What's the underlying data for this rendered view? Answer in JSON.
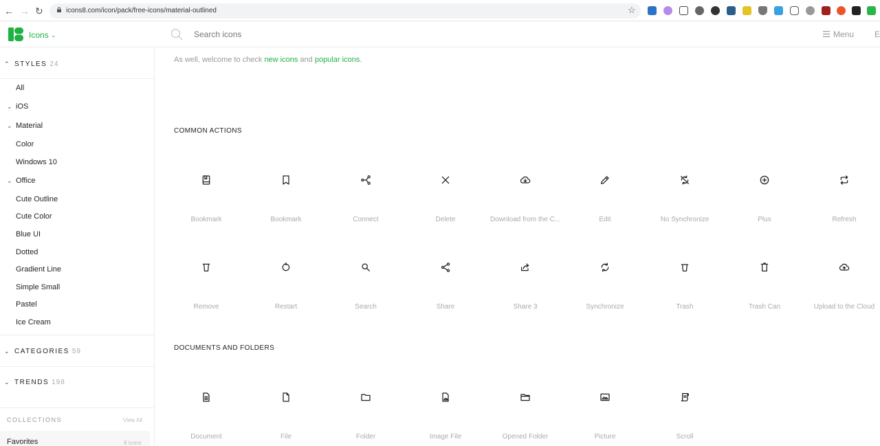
{
  "browser": {
    "url": "icons8.com/icon/pack/free-icons/material-outlined"
  },
  "header": {
    "brand": "Icons",
    "search_placeholder": "Search icons",
    "menu_label": "Menu",
    "edge_letter": "E"
  },
  "sidebar": {
    "styles_label": "STYLES",
    "styles_count": "24",
    "style_items": [
      "All",
      "iOS",
      "Material",
      "Color",
      "Windows 10",
      "Office",
      "Cute Outline",
      "Cute Color",
      "Blue UI",
      "Dotted",
      "Gradient Line",
      "Simple Small",
      "Pastel",
      "Ice Cream"
    ],
    "categories_label": "CATEGORIES",
    "categories_count": "59",
    "trends_label": "TRENDS",
    "trends_count": "198",
    "collections_label": "COLLECTIONS",
    "view_all": "View All",
    "favorites_label": "Favorites",
    "favorites_count": "8 icons"
  },
  "intro": {
    "before": "As well, welcome to check ",
    "new_icons": "new icons",
    "middle": " and ",
    "popular_icons": "popular icons",
    "after": "."
  },
  "sections": [
    {
      "title": "COMMON ACTIONS",
      "icons": [
        {
          "label": "Bookmark",
          "icon": "bookmark-book-icon"
        },
        {
          "label": "Bookmark",
          "icon": "bookmark-icon"
        },
        {
          "label": "Connect",
          "icon": "connect-icon"
        },
        {
          "label": "Delete",
          "icon": "delete-icon"
        },
        {
          "label": "Download from the C...",
          "icon": "cloud-download-icon"
        },
        {
          "label": "Edit",
          "icon": "edit-icon"
        },
        {
          "label": "No Synchronize",
          "icon": "no-sync-icon"
        },
        {
          "label": "Plus",
          "icon": "plus-icon"
        },
        {
          "label": "Refresh",
          "icon": "refresh-icon"
        },
        {
          "label": "Remove",
          "icon": "remove-icon"
        },
        {
          "label": "Restart",
          "icon": "restart-icon"
        },
        {
          "label": "Search",
          "icon": "search-icon"
        },
        {
          "label": "Share",
          "icon": "share-icon"
        },
        {
          "label": "Share 3",
          "icon": "share-3-icon"
        },
        {
          "label": "Synchronize",
          "icon": "sync-icon"
        },
        {
          "label": "Trash",
          "icon": "trash-icon"
        },
        {
          "label": "Trash Can",
          "icon": "trash-can-icon"
        },
        {
          "label": "Upload to the Cloud",
          "icon": "cloud-upload-icon"
        }
      ]
    },
    {
      "title": "DOCUMENTS AND FOLDERS",
      "icons": [
        {
          "label": "Document",
          "icon": "document-icon"
        },
        {
          "label": "File",
          "icon": "file-icon"
        },
        {
          "label": "Folder",
          "icon": "folder-icon"
        },
        {
          "label": "Image File",
          "icon": "image-file-icon"
        },
        {
          "label": "Opened Folder",
          "icon": "opened-folder-icon"
        },
        {
          "label": "Picture",
          "icon": "picture-icon"
        },
        {
          "label": "Scroll",
          "icon": "scroll-icon"
        }
      ]
    }
  ]
}
